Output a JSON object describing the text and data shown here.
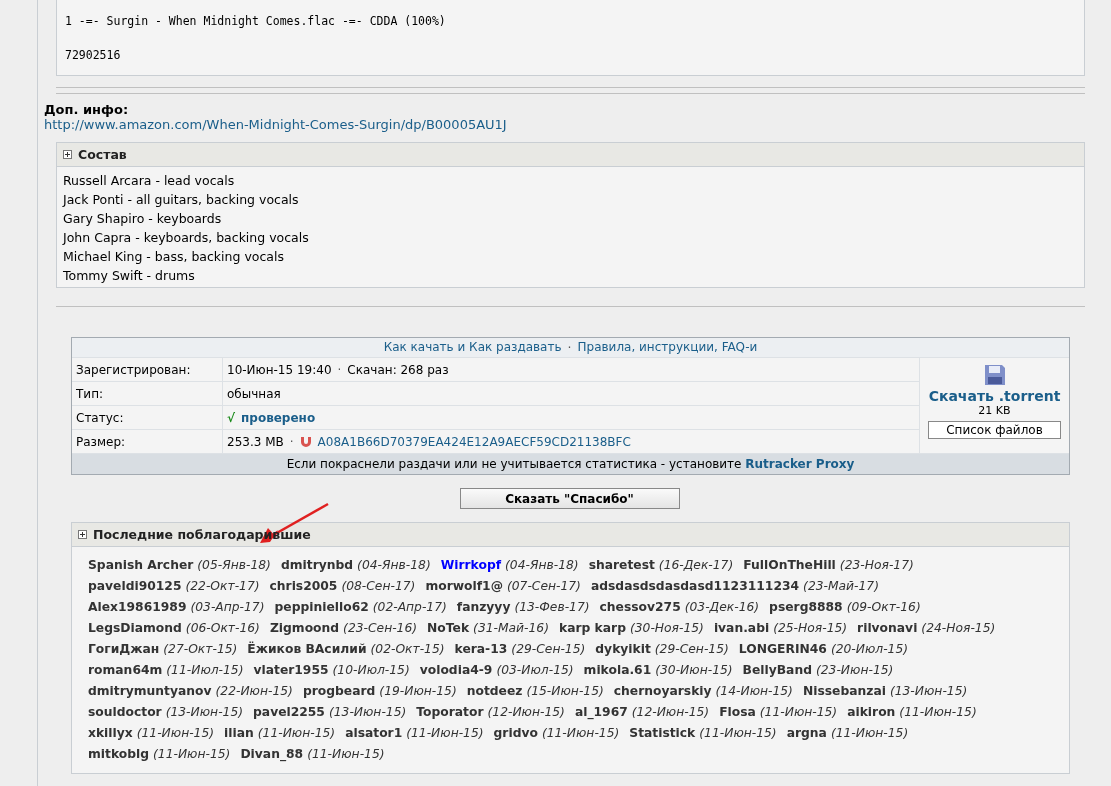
{
  "code_block": {
    "lines": [
      "1 -=- Surgin - When Midnight Comes.flac -=- CDDA (100%)",
      "72902516"
    ]
  },
  "extra_info": {
    "label": "Доп. инфо:",
    "link": "http://www.amazon.com/When-Midnight-Comes-Surgin/dp/B00005AU1J"
  },
  "lineup": {
    "title": "Состав",
    "expanded": false,
    "members": [
      "Russell Arcara - lead vocals",
      "Jack Ponti - all guitars, backing vocals",
      "Gary Shapiro - keyboards",
      "John Capra - keyboards, backing vocals",
      "Michael King - bass, backing vocals",
      "Tommy Swift - drums"
    ]
  },
  "torrent": {
    "header_links": [
      "Как качать и Как раздавать",
      "Правила, инструкции, FAQ-и"
    ],
    "separator": "·",
    "rows": [
      {
        "kind": "text",
        "label": "Зарегистрирован:",
        "value": "10-Июн-15 19:40",
        "extra": "Скачан: 268 раз"
      },
      {
        "kind": "text",
        "label": "Тип:",
        "value": "обычная"
      },
      {
        "kind": "status",
        "label": "Статус:",
        "mark": "√",
        "value": "проверено"
      },
      {
        "kind": "size",
        "label": "Размер:",
        "value": "253.3 MB",
        "hash": "A08A1B66D70379EA424E12A9AECF59CD21138BFC"
      }
    ],
    "download": {
      "label": "Скачать .torrent",
      "size": "21 KB",
      "files_button": "Список файлов"
    },
    "footer": {
      "text": "Если покраснели раздачи или не учитывается статистика - установите",
      "link": "Rutracker Proxy"
    }
  },
  "thanks_button": "Сказать \"Спасибо\"",
  "thanks": {
    "title": "Последние поблагодарившие",
    "expanded": false,
    "rows": [
      [
        {
          "name": "Spanish Archer",
          "date": "(05-Янв-18)",
          "color": "#333333"
        },
        {
          "name": "dmitrynbd",
          "date": "(04-Янв-18)",
          "color": "#333333"
        },
        {
          "name": "Wirrkopf",
          "date": "(04-Янв-18)",
          "color": "#0000ff"
        },
        {
          "name": "sharetest",
          "date": "(16-Дек-17)",
          "color": "#333333"
        },
        {
          "name": "FullOnTheHill",
          "date": "(23-Ноя-17)",
          "color": "#333333"
        }
      ],
      [
        {
          "name": "paveldi90125",
          "date": "(22-Окт-17)",
          "color": "#333333"
        },
        {
          "name": "chris2005",
          "date": "(08-Сен-17)",
          "color": "#333333"
        },
        {
          "name": "morwolf1@",
          "date": "(07-Сен-17)",
          "color": "#333333"
        },
        {
          "name": "adsdasdsdasdasd1123111234",
          "date": "(23-Май-17)",
          "color": "#333333"
        }
      ],
      [
        {
          "name": "Alex19861989",
          "date": "(03-Апр-17)",
          "color": "#333333"
        },
        {
          "name": "peppiniello62",
          "date": "(02-Апр-17)",
          "color": "#333333"
        },
        {
          "name": "fanzyyy",
          "date": "(13-Фев-17)",
          "color": "#333333"
        },
        {
          "name": "chessov275",
          "date": "(03-Дек-16)",
          "color": "#333333"
        },
        {
          "name": "pserg8888",
          "date": "(09-Окт-16)",
          "color": "#333333"
        }
      ],
      [
        {
          "name": "LegsDiamond",
          "date": "(06-Окт-16)",
          "color": "#333333"
        },
        {
          "name": "Zigmoond",
          "date": "(23-Сен-16)",
          "color": "#333333"
        },
        {
          "name": "NoTek",
          "date": "(31-Май-16)",
          "color": "#333333"
        },
        {
          "name": "karp karp",
          "date": "(30-Ноя-15)",
          "color": "#333333"
        },
        {
          "name": "ivan.abi",
          "date": "(25-Ноя-15)",
          "color": "#333333"
        },
        {
          "name": "rilvonavi",
          "date": "(24-Ноя-15)",
          "color": "#333333"
        }
      ],
      [
        {
          "name": "ГогиДжан",
          "date": "(27-Окт-15)",
          "color": "#333333"
        },
        {
          "name": "Ёжиков ВАсилий",
          "date": "(02-Окт-15)",
          "color": "#333333"
        },
        {
          "name": "kera-13",
          "date": "(29-Сен-15)",
          "color": "#333333"
        },
        {
          "name": "dykyikit",
          "date": "(29-Сен-15)",
          "color": "#333333"
        },
        {
          "name": "LONGERIN46",
          "date": "(20-Июл-15)",
          "color": "#333333"
        }
      ],
      [
        {
          "name": "roman64m",
          "date": "(11-Июл-15)",
          "color": "#333333"
        },
        {
          "name": "vlater1955",
          "date": "(10-Июл-15)",
          "color": "#333333"
        },
        {
          "name": "volodia4-9",
          "date": "(03-Июл-15)",
          "color": "#333333"
        },
        {
          "name": "mikola.61",
          "date": "(30-Июн-15)",
          "color": "#333333"
        },
        {
          "name": "BellyBand",
          "date": "(23-Июн-15)",
          "color": "#333333"
        }
      ],
      [
        {
          "name": "dmitrymuntyanov",
          "date": "(22-Июн-15)",
          "color": "#333333"
        },
        {
          "name": "progbeard",
          "date": "(19-Июн-15)",
          "color": "#333333"
        },
        {
          "name": "notdeez",
          "date": "(15-Июн-15)",
          "color": "#333333"
        },
        {
          "name": "chernoyarskiy",
          "date": "(14-Июн-15)",
          "color": "#333333"
        },
        {
          "name": "Nissebanzai",
          "date": "(13-Июн-15)",
          "color": "#333333"
        }
      ],
      [
        {
          "name": "souldoctor",
          "date": "(13-Июн-15)",
          "color": "#333333"
        },
        {
          "name": "pavel2255",
          "date": "(13-Июн-15)",
          "color": "#333333"
        },
        {
          "name": "Toporator",
          "date": "(12-Июн-15)",
          "color": "#333333"
        },
        {
          "name": "al_1967",
          "date": "(12-Июн-15)",
          "color": "#333333"
        },
        {
          "name": "Flosa",
          "date": "(11-Июн-15)",
          "color": "#333333"
        },
        {
          "name": "aikiron",
          "date": "(11-Июн-15)",
          "color": "#333333"
        }
      ],
      [
        {
          "name": "xkillyx",
          "date": "(11-Июн-15)",
          "color": "#333333"
        },
        {
          "name": "ilian",
          "date": "(11-Июн-15)",
          "color": "#333333"
        },
        {
          "name": "alsator1",
          "date": "(11-Июн-15)",
          "color": "#333333"
        },
        {
          "name": "gridvo",
          "date": "(11-Июн-15)",
          "color": "#333333"
        },
        {
          "name": "Statistick",
          "date": "(11-Июн-15)",
          "color": "#333333"
        },
        {
          "name": "argna",
          "date": "(11-Июн-15)",
          "color": "#333333"
        }
      ],
      [
        {
          "name": "mitkoblg",
          "date": "(11-Июн-15)",
          "color": "#333333"
        },
        {
          "name": "Divan_88",
          "date": "(11-Июн-15)",
          "color": "#333333"
        }
      ]
    ]
  }
}
